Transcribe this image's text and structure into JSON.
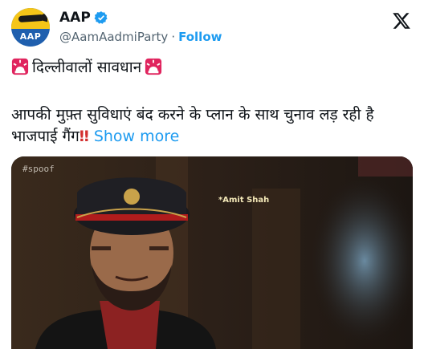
{
  "account": {
    "name": "AAP",
    "handle": "@AamAadmiParty",
    "separator": "·",
    "follow_label": "Follow",
    "avatar_text": "AAP",
    "verified": true
  },
  "tweet": {
    "line1": "दिल्लीवालों सावधान",
    "line2": "आपकी मुफ़्त सुविधाएं बंद करने के प्लान के साथ चुनाव लड़ रही है भाजपाई गैंग",
    "exclaim": "‼",
    "show_more": "Show more"
  },
  "media": {
    "watermark": "#spoof",
    "caption": "*Amit Shah"
  },
  "icons": [
    "verified-badge-icon",
    "x-logo-icon",
    "siren-icon"
  ],
  "colors": {
    "link": "#1d9bf0",
    "avatar_bg": "#1f5fae",
    "avatar_band": "#f5c518"
  }
}
